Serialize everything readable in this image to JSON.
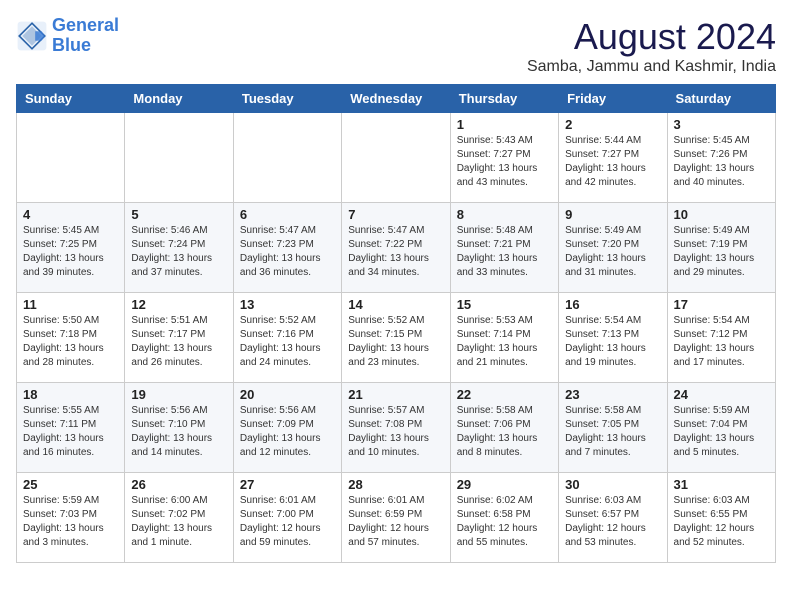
{
  "header": {
    "logo_line1": "General",
    "logo_line2": "Blue",
    "month_title": "August 2024",
    "subtitle": "Samba, Jammu and Kashmir, India"
  },
  "weekdays": [
    "Sunday",
    "Monday",
    "Tuesday",
    "Wednesday",
    "Thursday",
    "Friday",
    "Saturday"
  ],
  "weeks": [
    [
      {
        "day": "",
        "info": ""
      },
      {
        "day": "",
        "info": ""
      },
      {
        "day": "",
        "info": ""
      },
      {
        "day": "",
        "info": ""
      },
      {
        "day": "1",
        "info": "Sunrise: 5:43 AM\nSunset: 7:27 PM\nDaylight: 13 hours\nand 43 minutes."
      },
      {
        "day": "2",
        "info": "Sunrise: 5:44 AM\nSunset: 7:27 PM\nDaylight: 13 hours\nand 42 minutes."
      },
      {
        "day": "3",
        "info": "Sunrise: 5:45 AM\nSunset: 7:26 PM\nDaylight: 13 hours\nand 40 minutes."
      }
    ],
    [
      {
        "day": "4",
        "info": "Sunrise: 5:45 AM\nSunset: 7:25 PM\nDaylight: 13 hours\nand 39 minutes."
      },
      {
        "day": "5",
        "info": "Sunrise: 5:46 AM\nSunset: 7:24 PM\nDaylight: 13 hours\nand 37 minutes."
      },
      {
        "day": "6",
        "info": "Sunrise: 5:47 AM\nSunset: 7:23 PM\nDaylight: 13 hours\nand 36 minutes."
      },
      {
        "day": "7",
        "info": "Sunrise: 5:47 AM\nSunset: 7:22 PM\nDaylight: 13 hours\nand 34 minutes."
      },
      {
        "day": "8",
        "info": "Sunrise: 5:48 AM\nSunset: 7:21 PM\nDaylight: 13 hours\nand 33 minutes."
      },
      {
        "day": "9",
        "info": "Sunrise: 5:49 AM\nSunset: 7:20 PM\nDaylight: 13 hours\nand 31 minutes."
      },
      {
        "day": "10",
        "info": "Sunrise: 5:49 AM\nSunset: 7:19 PM\nDaylight: 13 hours\nand 29 minutes."
      }
    ],
    [
      {
        "day": "11",
        "info": "Sunrise: 5:50 AM\nSunset: 7:18 PM\nDaylight: 13 hours\nand 28 minutes."
      },
      {
        "day": "12",
        "info": "Sunrise: 5:51 AM\nSunset: 7:17 PM\nDaylight: 13 hours\nand 26 minutes."
      },
      {
        "day": "13",
        "info": "Sunrise: 5:52 AM\nSunset: 7:16 PM\nDaylight: 13 hours\nand 24 minutes."
      },
      {
        "day": "14",
        "info": "Sunrise: 5:52 AM\nSunset: 7:15 PM\nDaylight: 13 hours\nand 23 minutes."
      },
      {
        "day": "15",
        "info": "Sunrise: 5:53 AM\nSunset: 7:14 PM\nDaylight: 13 hours\nand 21 minutes."
      },
      {
        "day": "16",
        "info": "Sunrise: 5:54 AM\nSunset: 7:13 PM\nDaylight: 13 hours\nand 19 minutes."
      },
      {
        "day": "17",
        "info": "Sunrise: 5:54 AM\nSunset: 7:12 PM\nDaylight: 13 hours\nand 17 minutes."
      }
    ],
    [
      {
        "day": "18",
        "info": "Sunrise: 5:55 AM\nSunset: 7:11 PM\nDaylight: 13 hours\nand 16 minutes."
      },
      {
        "day": "19",
        "info": "Sunrise: 5:56 AM\nSunset: 7:10 PM\nDaylight: 13 hours\nand 14 minutes."
      },
      {
        "day": "20",
        "info": "Sunrise: 5:56 AM\nSunset: 7:09 PM\nDaylight: 13 hours\nand 12 minutes."
      },
      {
        "day": "21",
        "info": "Sunrise: 5:57 AM\nSunset: 7:08 PM\nDaylight: 13 hours\nand 10 minutes."
      },
      {
        "day": "22",
        "info": "Sunrise: 5:58 AM\nSunset: 7:06 PM\nDaylight: 13 hours\nand 8 minutes."
      },
      {
        "day": "23",
        "info": "Sunrise: 5:58 AM\nSunset: 7:05 PM\nDaylight: 13 hours\nand 7 minutes."
      },
      {
        "day": "24",
        "info": "Sunrise: 5:59 AM\nSunset: 7:04 PM\nDaylight: 13 hours\nand 5 minutes."
      }
    ],
    [
      {
        "day": "25",
        "info": "Sunrise: 5:59 AM\nSunset: 7:03 PM\nDaylight: 13 hours\nand 3 minutes."
      },
      {
        "day": "26",
        "info": "Sunrise: 6:00 AM\nSunset: 7:02 PM\nDaylight: 13 hours\nand 1 minute."
      },
      {
        "day": "27",
        "info": "Sunrise: 6:01 AM\nSunset: 7:00 PM\nDaylight: 12 hours\nand 59 minutes."
      },
      {
        "day": "28",
        "info": "Sunrise: 6:01 AM\nSunset: 6:59 PM\nDaylight: 12 hours\nand 57 minutes."
      },
      {
        "day": "29",
        "info": "Sunrise: 6:02 AM\nSunset: 6:58 PM\nDaylight: 12 hours\nand 55 minutes."
      },
      {
        "day": "30",
        "info": "Sunrise: 6:03 AM\nSunset: 6:57 PM\nDaylight: 12 hours\nand 53 minutes."
      },
      {
        "day": "31",
        "info": "Sunrise: 6:03 AM\nSunset: 6:55 PM\nDaylight: 12 hours\nand 52 minutes."
      }
    ]
  ]
}
